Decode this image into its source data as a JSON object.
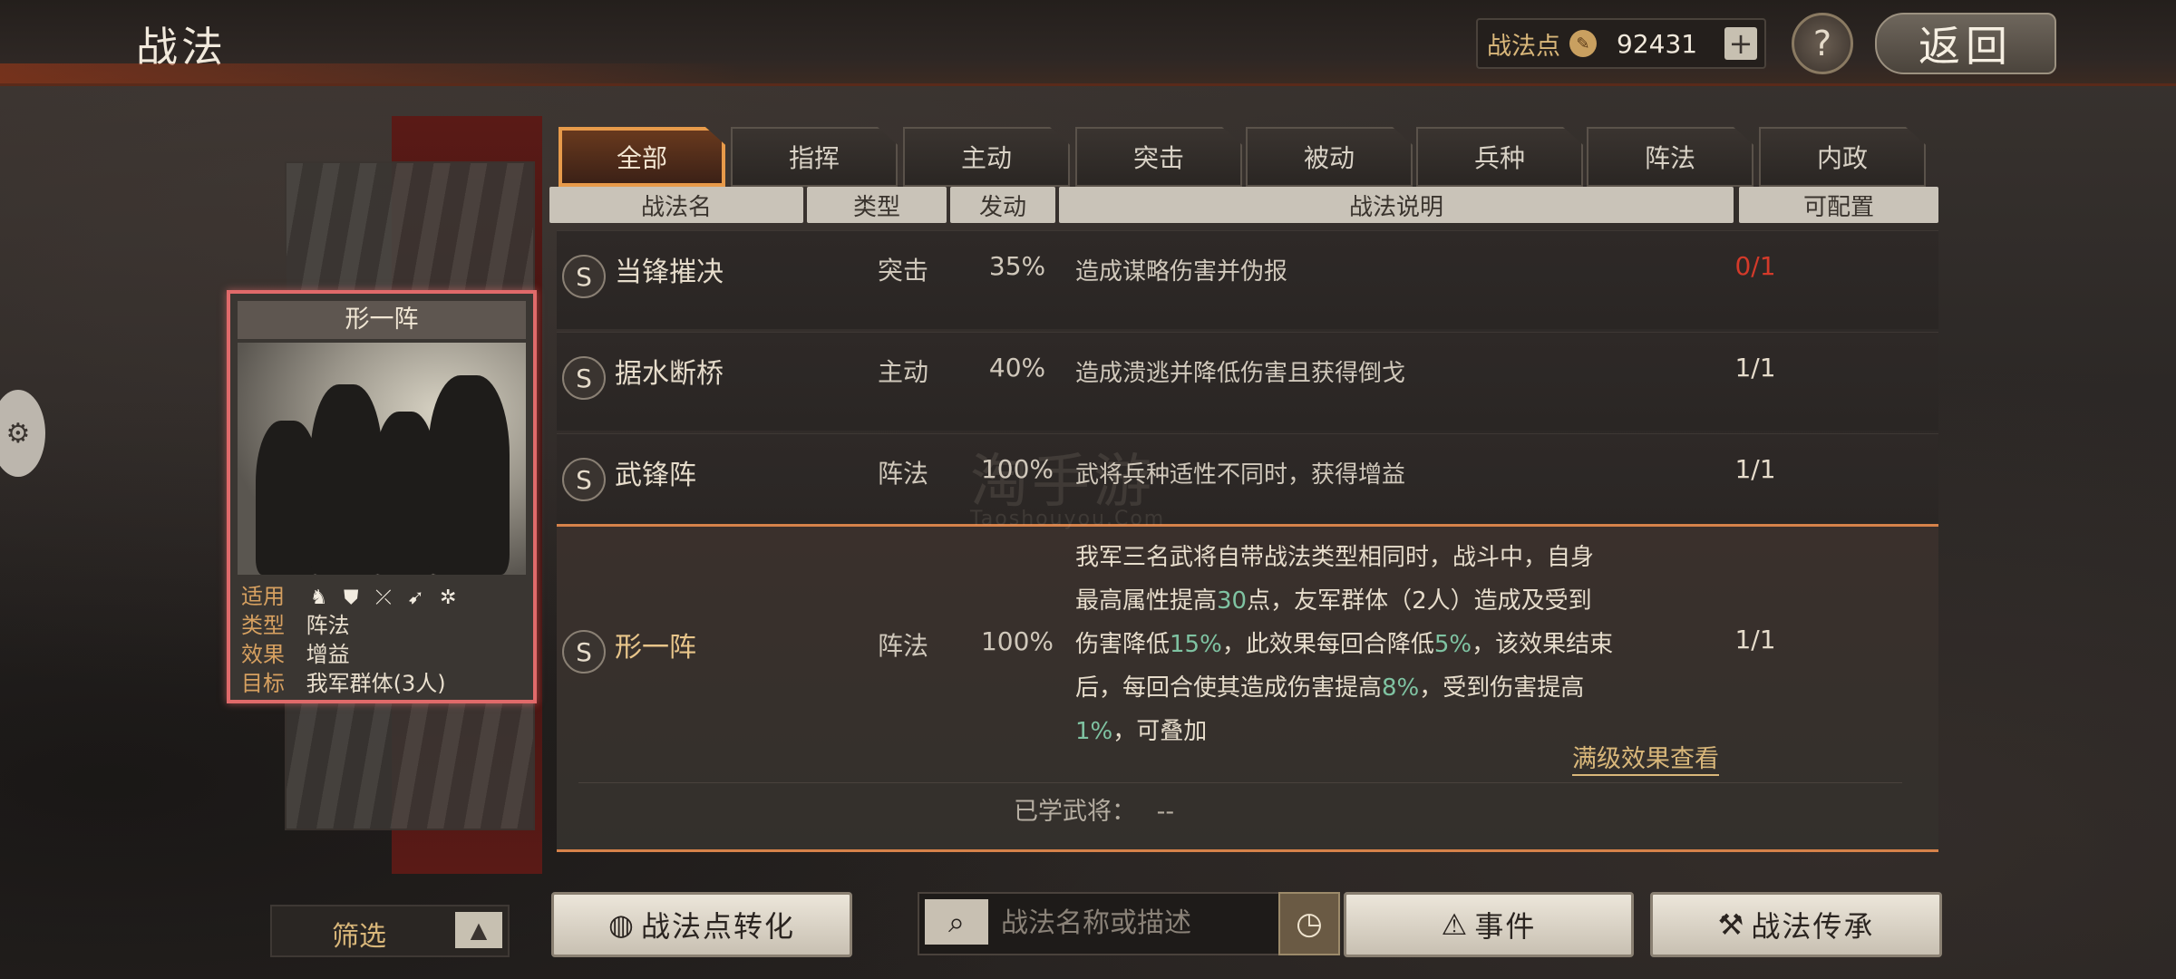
{
  "header": {
    "title": "战法",
    "points_label": "战法点",
    "points_value": "92431",
    "help_label": "?",
    "back_label": "返回"
  },
  "card": {
    "name": "形一阵",
    "applicable_label": "适用",
    "applicable_icons": [
      "horse-icon",
      "shield-icon",
      "bow-icon",
      "spear-icon",
      "wheel-icon"
    ],
    "type_label": "类型",
    "type_value": "阵法",
    "effect_label": "效果",
    "effect_value": "增益",
    "target_label": "目标",
    "target_value": "我军群体(3人)"
  },
  "tabs": [
    "全部",
    "指挥",
    "主动",
    "突击",
    "被动",
    "兵种",
    "阵法",
    "内政"
  ],
  "active_tab": 0,
  "columns": {
    "name": "战法名",
    "type": "类型",
    "rate": "发动",
    "desc": "战法说明",
    "config": "可配置"
  },
  "rows": [
    {
      "badge": "S",
      "name": "当锋摧决",
      "type": "突击",
      "rate": "35%",
      "desc": "造成谋略伤害并伪报",
      "config": "0/1"
    },
    {
      "badge": "S",
      "name": "据水断桥",
      "type": "主动",
      "rate": "40%",
      "desc": "造成溃逃并降低伤害且获得倒戈",
      "config": "1/1"
    },
    {
      "badge": "S",
      "name": "武锋阵",
      "type": "阵法",
      "rate": "100%",
      "desc": "武将兵种适性不同时，获得增益",
      "config": "1/1"
    }
  ],
  "selected": {
    "badge": "S",
    "name": "形一阵",
    "type": "阵法",
    "rate": "100%",
    "config": "1/1",
    "desc_1": "我军三名武将自带战法类型相同时，战斗中，自身",
    "desc_2a": "最高属性提高",
    "desc_2b": "30",
    "desc_2c": "点，友军群体（2人）造成及受到",
    "desc_3a": "伤害降低",
    "desc_3b": "15%",
    "desc_3c": "，此效果每回合降低",
    "desc_3d": "5%",
    "desc_3e": "，该效果结束",
    "desc_4a": "后，每回合使其造成伤害提高",
    "desc_4b": "8%",
    "desc_4c": "，受到伤害提高",
    "desc_5a": "1%",
    "desc_5b": "，可叠加",
    "full_effect_link": "满级效果查看",
    "learned_label": "已学武将：",
    "learned_value": "--"
  },
  "watermark": {
    "cn": "淘手游",
    "en": "Taoshouyou.Com"
  },
  "bottom": {
    "filter_label": "筛选",
    "convert_label": "战法点转化",
    "search_placeholder": "战法名称或描述",
    "event_label": "事件",
    "inherit_label": "战法传承"
  },
  "colors": {
    "accent": "#e79a4a",
    "highlight_green": "#7fc3a2",
    "red": "#d33a2a",
    "card_border": "#e06a6a"
  }
}
